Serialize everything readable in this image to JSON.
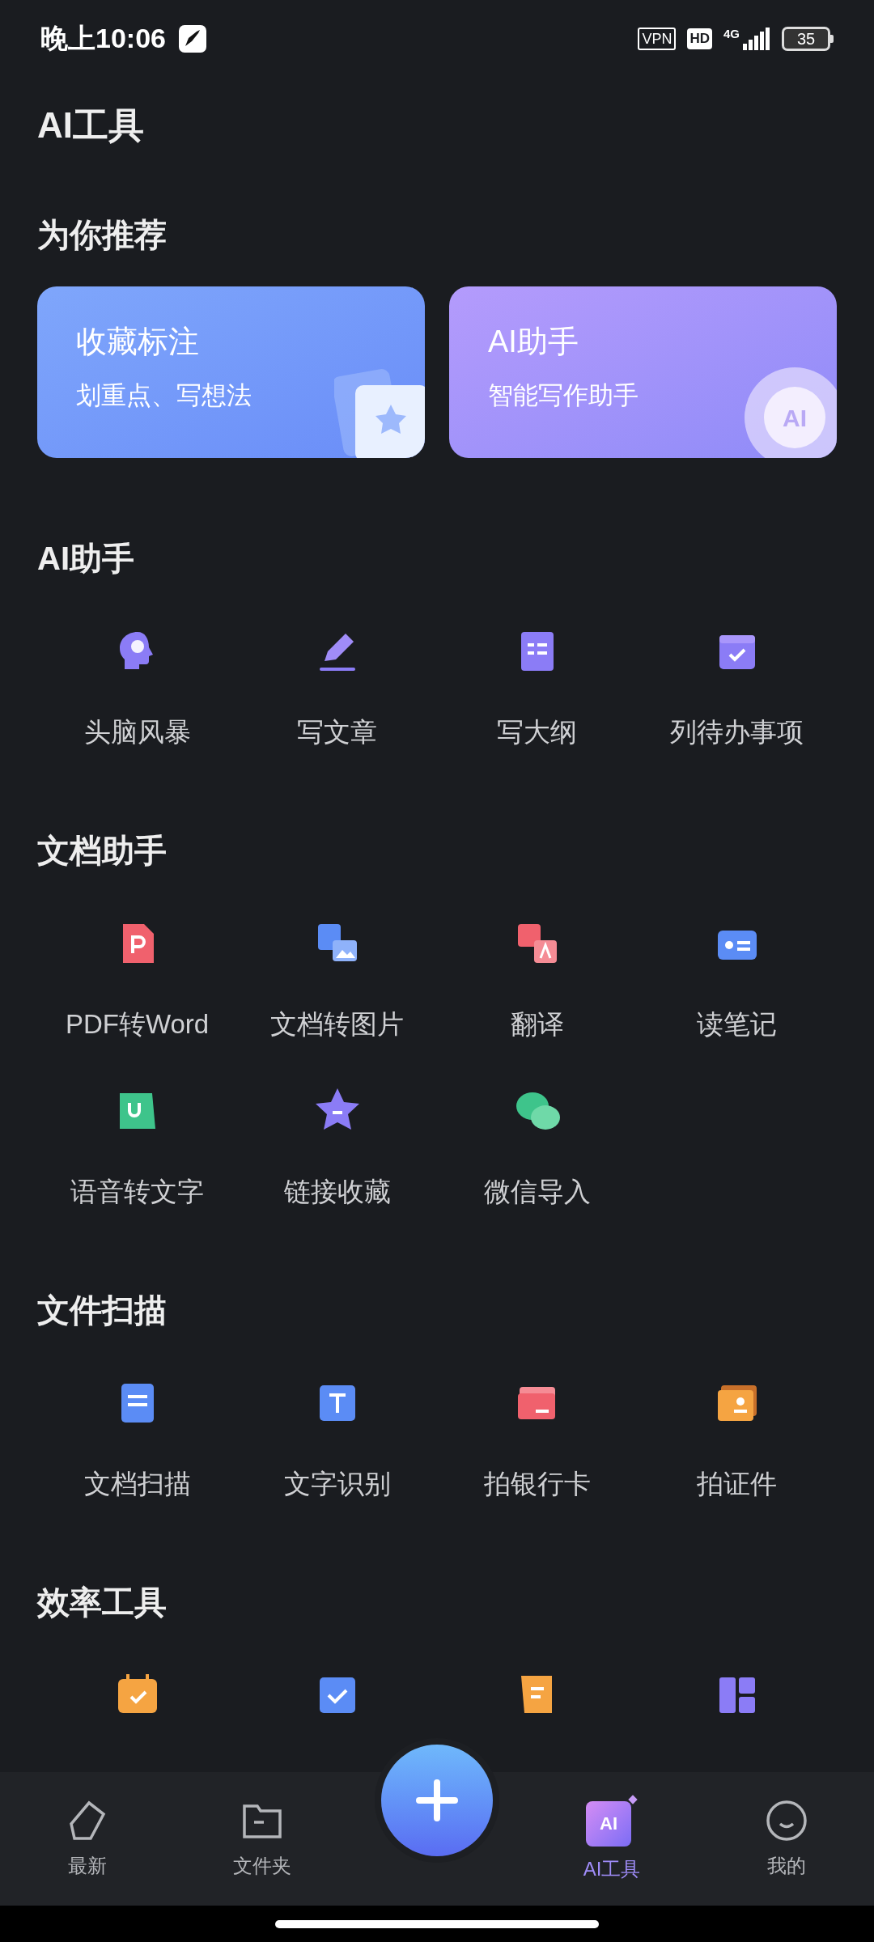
{
  "status_bar": {
    "time": "晚上10:06",
    "vpn": "VPN",
    "hd": "HD",
    "network": "4G",
    "battery": "35"
  },
  "title": "AI工具",
  "recommend": {
    "heading": "为你推荐",
    "cards": [
      {
        "title": "收藏标注",
        "subtitle": "划重点、写想法",
        "kind": "star"
      },
      {
        "title": "AI助手",
        "subtitle": "智能写作助手",
        "kind": "ai",
        "icon_text": "AI"
      }
    ]
  },
  "sections": [
    {
      "heading": "AI助手",
      "items": [
        {
          "label": "头脑风暴"
        },
        {
          "label": "写文章"
        },
        {
          "label": "写大纲"
        },
        {
          "label": "列待办事项"
        }
      ]
    },
    {
      "heading": "文档助手",
      "items": [
        {
          "label": "PDF转Word"
        },
        {
          "label": "文档转图片"
        },
        {
          "label": "翻译"
        },
        {
          "label": "读笔记"
        },
        {
          "label": "语音转文字"
        },
        {
          "label": "链接收藏"
        },
        {
          "label": "微信导入"
        }
      ]
    },
    {
      "heading": "文件扫描",
      "items": [
        {
          "label": "文档扫描"
        },
        {
          "label": "文字识别"
        },
        {
          "label": "拍银行卡"
        },
        {
          "label": "拍证件"
        }
      ]
    },
    {
      "heading": "效率工具"
    }
  ],
  "bottom_nav": [
    {
      "label": "最新",
      "selected": false
    },
    {
      "label": "文件夹",
      "selected": false
    },
    {
      "label": "AI工具",
      "selected": true,
      "icon_text": "AI"
    },
    {
      "label": "我的",
      "selected": false
    }
  ]
}
